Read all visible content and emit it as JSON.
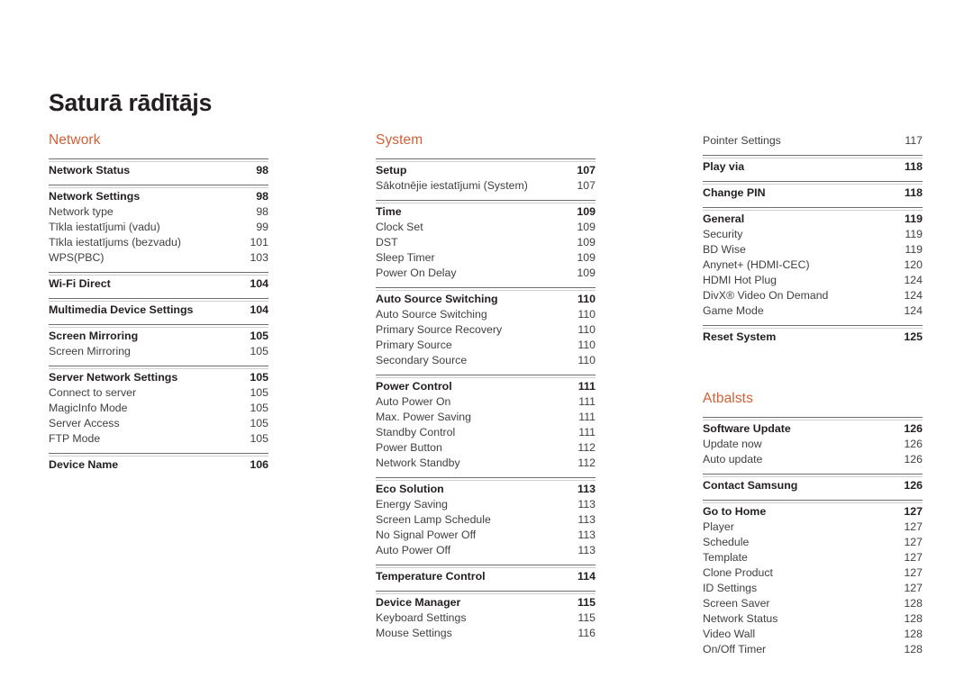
{
  "document": {
    "title": "Saturā rādītājs",
    "accent_color": "#cf6039",
    "text_color": "#231f20",
    "rule_color": "#6d6e71"
  },
  "columns": [
    {
      "name": "column-1",
      "sections": [
        {
          "heading": "Network",
          "heading_visible": true,
          "groups": [
            {
              "ruled": true,
              "rows": [
                {
                  "label": "Network Status",
                  "page": "98",
                  "bold": true
                }
              ]
            },
            {
              "ruled": true,
              "rows": [
                {
                  "label": "Network Settings",
                  "page": "98",
                  "bold": true
                },
                {
                  "label": "Network type",
                  "page": "98",
                  "bold": false
                },
                {
                  "label": "Tīkla iestatījumi (vadu)",
                  "page": "99",
                  "bold": false
                },
                {
                  "label": "Tīkla iestatījums (bezvadu)",
                  "page": "101",
                  "bold": false
                },
                {
                  "label": "WPS(PBC)",
                  "page": "103",
                  "bold": false
                }
              ]
            },
            {
              "ruled": true,
              "rows": [
                {
                  "label": "Wi-Fi Direct",
                  "page": "104",
                  "bold": true
                }
              ]
            },
            {
              "ruled": true,
              "rows": [
                {
                  "label": "Multimedia Device Settings",
                  "page": "104",
                  "bold": true
                }
              ]
            },
            {
              "ruled": true,
              "rows": [
                {
                  "label": "Screen Mirroring",
                  "page": "105",
                  "bold": true
                },
                {
                  "label": "Screen Mirroring",
                  "page": "105",
                  "bold": false
                }
              ]
            },
            {
              "ruled": true,
              "rows": [
                {
                  "label": "Server Network Settings",
                  "page": "105",
                  "bold": true
                },
                {
                  "label": "Connect to server",
                  "page": "105",
                  "bold": false
                },
                {
                  "label": "MagicInfo Mode",
                  "page": "105",
                  "bold": false
                },
                {
                  "label": "Server Access",
                  "page": "105",
                  "bold": false
                },
                {
                  "label": "FTP Mode",
                  "page": "105",
                  "bold": false
                }
              ]
            },
            {
              "ruled": true,
              "rows": [
                {
                  "label": "Device Name",
                  "page": "106",
                  "bold": true
                }
              ]
            }
          ]
        }
      ]
    },
    {
      "name": "column-2",
      "sections": [
        {
          "heading": "System",
          "heading_visible": true,
          "groups": [
            {
              "ruled": true,
              "rows": [
                {
                  "label": "Setup",
                  "page": "107",
                  "bold": true
                },
                {
                  "label": "Sākotnējie iestatījumi (System)",
                  "page": "107",
                  "bold": false
                }
              ]
            },
            {
              "ruled": true,
              "rows": [
                {
                  "label": "Time",
                  "page": "109",
                  "bold": true
                },
                {
                  "label": "Clock Set",
                  "page": "109",
                  "bold": false
                },
                {
                  "label": "DST",
                  "page": "109",
                  "bold": false
                },
                {
                  "label": "Sleep Timer",
                  "page": "109",
                  "bold": false
                },
                {
                  "label": "Power On Delay",
                  "page": "109",
                  "bold": false
                }
              ]
            },
            {
              "ruled": true,
              "rows": [
                {
                  "label": "Auto Source Switching",
                  "page": "110",
                  "bold": true
                },
                {
                  "label": "Auto Source Switching",
                  "page": "110",
                  "bold": false
                },
                {
                  "label": "Primary Source Recovery",
                  "page": "110",
                  "bold": false
                },
                {
                  "label": "Primary Source",
                  "page": "110",
                  "bold": false
                },
                {
                  "label": "Secondary Source",
                  "page": "110",
                  "bold": false
                }
              ]
            },
            {
              "ruled": true,
              "rows": [
                {
                  "label": "Power Control",
                  "page": "111",
                  "bold": true
                },
                {
                  "label": "Auto Power On",
                  "page": "111",
                  "bold": false
                },
                {
                  "label": "Max. Power Saving",
                  "page": "111",
                  "bold": false
                },
                {
                  "label": "Standby Control",
                  "page": "111",
                  "bold": false
                },
                {
                  "label": "Power Button",
                  "page": "112",
                  "bold": false
                },
                {
                  "label": "Network Standby",
                  "page": "112",
                  "bold": false
                }
              ]
            },
            {
              "ruled": true,
              "rows": [
                {
                  "label": "Eco Solution",
                  "page": "113",
                  "bold": true
                },
                {
                  "label": "Energy Saving",
                  "page": "113",
                  "bold": false
                },
                {
                  "label": "Screen Lamp Schedule",
                  "page": "113",
                  "bold": false
                },
                {
                  "label": "No Signal Power Off",
                  "page": "113",
                  "bold": false
                },
                {
                  "label": "Auto Power Off",
                  "page": "113",
                  "bold": false
                }
              ]
            },
            {
              "ruled": true,
              "rows": [
                {
                  "label": "Temperature Control",
                  "page": "114",
                  "bold": true
                }
              ]
            },
            {
              "ruled": true,
              "rows": [
                {
                  "label": "Device Manager",
                  "page": "115",
                  "bold": true
                },
                {
                  "label": "Keyboard Settings",
                  "page": "115",
                  "bold": false
                },
                {
                  "label": "Mouse Settings",
                  "page": "116",
                  "bold": false
                }
              ]
            }
          ]
        }
      ]
    },
    {
      "name": "column-3",
      "sections": [
        {
          "heading": "",
          "heading_visible": false,
          "groups": [
            {
              "ruled": false,
              "rows": [
                {
                  "label": "Pointer Settings",
                  "page": "117",
                  "bold": false
                }
              ]
            },
            {
              "ruled": true,
              "rows": [
                {
                  "label": "Play via",
                  "page": "118",
                  "bold": true
                }
              ]
            },
            {
              "ruled": true,
              "rows": [
                {
                  "label": "Change PIN",
                  "page": "118",
                  "bold": true
                }
              ]
            },
            {
              "ruled": true,
              "rows": [
                {
                  "label": "General",
                  "page": "119",
                  "bold": true
                },
                {
                  "label": "Security",
                  "page": "119",
                  "bold": false
                },
                {
                  "label": "BD Wise",
                  "page": "119",
                  "bold": false
                },
                {
                  "label": "Anynet+ (HDMI-CEC)",
                  "page": "120",
                  "bold": false
                },
                {
                  "label": "HDMI Hot Plug",
                  "page": "124",
                  "bold": false
                },
                {
                  "label": "DivX® Video On Demand",
                  "page": "124",
                  "bold": false
                },
                {
                  "label": "Game Mode",
                  "page": "124",
                  "bold": false
                }
              ]
            },
            {
              "ruled": true,
              "rows": [
                {
                  "label": "Reset System",
                  "page": "125",
                  "bold": true
                }
              ]
            }
          ]
        },
        {
          "heading": "Atbalsts",
          "heading_visible": true,
          "spaced_above": true,
          "groups": [
            {
              "ruled": true,
              "rows": [
                {
                  "label": "Software Update",
                  "page": "126",
                  "bold": true
                },
                {
                  "label": "Update now",
                  "page": "126",
                  "bold": false
                },
                {
                  "label": "Auto update",
                  "page": "126",
                  "bold": false
                }
              ]
            },
            {
              "ruled": true,
              "rows": [
                {
                  "label": "Contact Samsung",
                  "page": "126",
                  "bold": true
                }
              ]
            },
            {
              "ruled": true,
              "rows": [
                {
                  "label": "Go to Home",
                  "page": "127",
                  "bold": true
                },
                {
                  "label": "Player",
                  "page": "127",
                  "bold": false
                },
                {
                  "label": "Schedule",
                  "page": "127",
                  "bold": false
                },
                {
                  "label": "Template",
                  "page": "127",
                  "bold": false
                },
                {
                  "label": "Clone Product",
                  "page": "127",
                  "bold": false
                },
                {
                  "label": "ID Settings",
                  "page": "127",
                  "bold": false
                },
                {
                  "label": "Screen Saver",
                  "page": "128",
                  "bold": false
                },
                {
                  "label": "Network Status",
                  "page": "128",
                  "bold": false
                },
                {
                  "label": "Video Wall",
                  "page": "128",
                  "bold": false
                },
                {
                  "label": "On/Off Timer",
                  "page": "128",
                  "bold": false
                }
              ]
            }
          ]
        }
      ]
    }
  ]
}
